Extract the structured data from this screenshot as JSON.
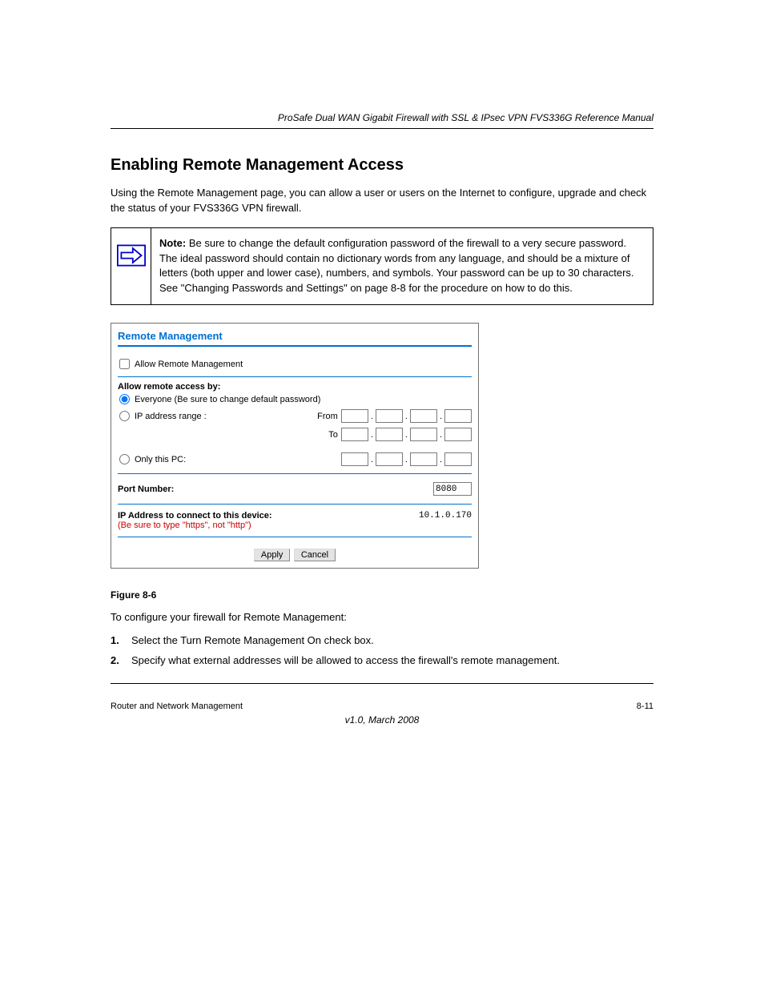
{
  "header": {
    "right": "ProSafe Dual WAN Gigabit Firewall with SSL & IPsec VPN FVS336G Reference Manual"
  },
  "heading": "Enabling Remote Management Access",
  "intro": "Using the Remote Management page, you can allow a user or users on the Internet to configure, upgrade and check the status of your FVS336G VPN firewall.",
  "note": {
    "label": "Note:",
    "body_a": " Be sure to change the default configuration password of the firewall to a very secure password. The ideal password should contain no dictionary words from any language, and should be a mixture of letters (both upper and lower case), numbers, and symbols. Your password can be up to 30 characters. See ",
    "link": "\"Changing Passwords and Settings\" on page 8-8",
    "body_b": " for the procedure on how to do this."
  },
  "panel": {
    "title": "Remote Management",
    "allow": "Allow Remote Management",
    "subhead": "Allow remote access by:",
    "opt_everyone": "Everyone (Be sure to change default password)",
    "opt_range": "IP address range :",
    "from": "From",
    "to": "To",
    "opt_onlypc": "Only this PC:",
    "portnum_label": "Port Number:",
    "portnum_value": "8080",
    "addr_label": "IP Address to connect to this device:",
    "addr_hint": "(Be sure to type \"https\", not \"http\")",
    "addr_ip": "10.1.0.170",
    "apply": "Apply",
    "cancel": "Cancel"
  },
  "figcaption": "Figure 8-6",
  "configline": "To configure your firewall for Remote Management:",
  "steps": {
    "n1": "1.",
    "s1_a": "Select the Turn Remote Management On check box.",
    "n2": "2.",
    "s2_a": "Specify what external addresses will be allowed to access the firewall's remote management."
  },
  "footer": {
    "left": "Router and Network Management",
    "right": "8-11",
    "rev": "v1.0, March 2008"
  }
}
